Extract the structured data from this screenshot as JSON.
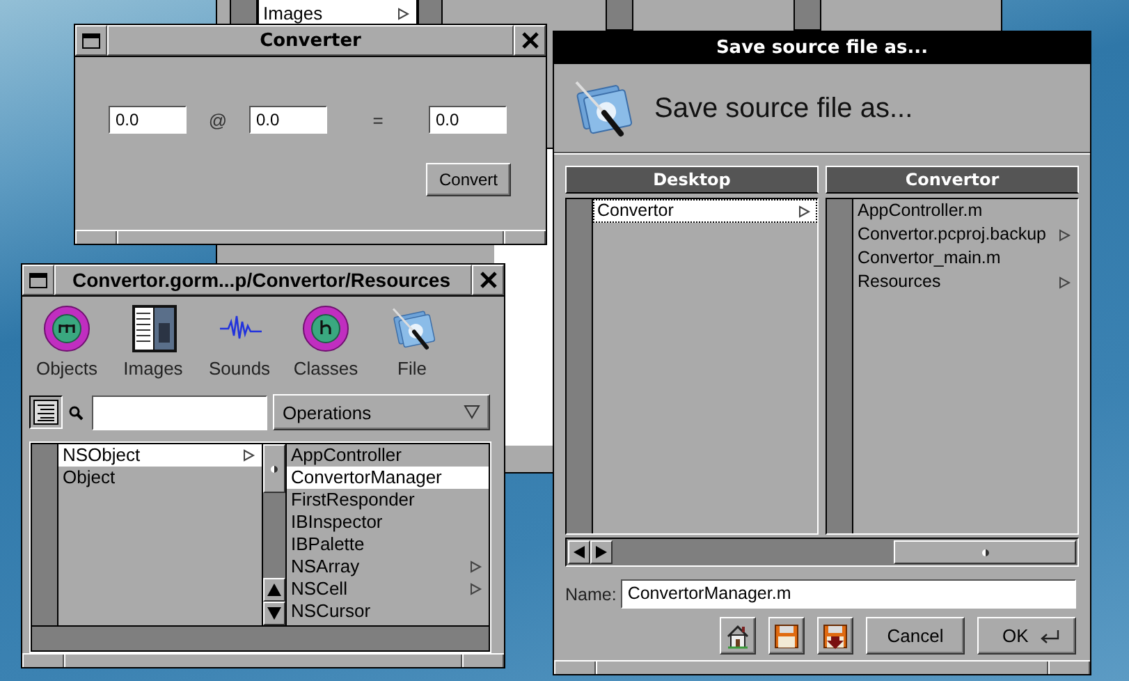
{
  "background_window": {
    "list_items": [
      {
        "label": "Images",
        "has_children": true
      }
    ]
  },
  "converter": {
    "title": "Converter",
    "fields": [
      {
        "value": "0.0"
      },
      {
        "value": "0.0"
      },
      {
        "value": "0.0"
      }
    ],
    "operators": [
      "@",
      "="
    ],
    "button": "Convert"
  },
  "gorm_document": {
    "title": "Convertor.gorm...p/Convertor/Resources",
    "views": [
      {
        "label": "Objects",
        "kind": "objects"
      },
      {
        "label": "Images",
        "kind": "images"
      },
      {
        "label": "Sounds",
        "kind": "sounds"
      },
      {
        "label": "Classes",
        "kind": "classes"
      },
      {
        "label": "File",
        "kind": "file"
      }
    ],
    "operations_popup": "Operations",
    "class_browser": {
      "columns": [
        {
          "items": [
            {
              "label": "NSObject",
              "has_children": true,
              "selected": true
            },
            {
              "label": "Object",
              "has_children": false,
              "selected": false
            }
          ]
        },
        {
          "items": [
            {
              "label": "AppController",
              "has_children": false,
              "selected": false
            },
            {
              "label": "ConvertorManager",
              "has_children": false,
              "selected": true
            },
            {
              "label": "FirstResponder",
              "has_children": false,
              "selected": false
            },
            {
              "label": "IBInspector",
              "has_children": false,
              "selected": false
            },
            {
              "label": "IBPalette",
              "has_children": false,
              "selected": false
            },
            {
              "label": "NSArray",
              "has_children": true,
              "selected": false
            },
            {
              "label": "NSCell",
              "has_children": true,
              "selected": false
            },
            {
              "label": "NSCursor",
              "has_children": false,
              "selected": false
            }
          ]
        }
      ]
    }
  },
  "save_panel": {
    "title": "Save source file as...",
    "heading": "Save source file as...",
    "browser": {
      "columns": [
        {
          "title": "Desktop",
          "items": [
            {
              "label": "Convertor",
              "has_children": true,
              "selected": true
            }
          ]
        },
        {
          "title": "Convertor",
          "items": [
            {
              "label": "AppController.m",
              "has_children": false,
              "selected": false
            },
            {
              "label": "Convertor.pcproj.backup",
              "has_children": true,
              "selected": false
            },
            {
              "label": "Convertor_main.m",
              "has_children": false,
              "selected": false
            },
            {
              "label": "Resources",
              "has_children": true,
              "selected": false
            }
          ]
        }
      ]
    },
    "name_label": "Name:",
    "name_value": "ConvertorManager.m",
    "buttons": [
      {
        "kind": "home"
      },
      {
        "kind": "save"
      },
      {
        "kind": "save_down"
      },
      {
        "kind": "text",
        "label": "Cancel"
      },
      {
        "kind": "default",
        "label": "OK"
      }
    ]
  }
}
